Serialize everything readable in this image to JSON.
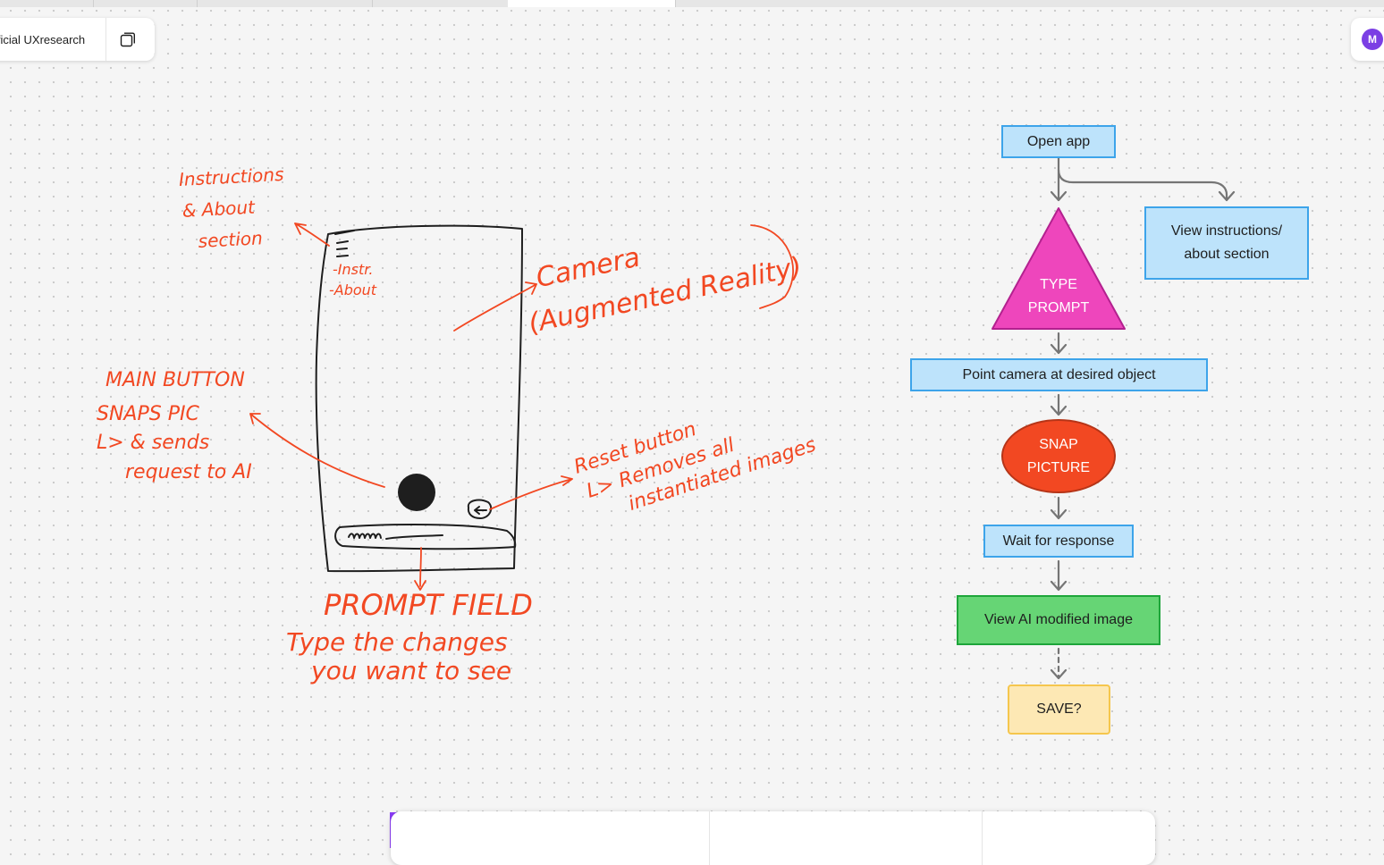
{
  "file": {
    "name": "ificial UXresearch"
  },
  "user": {
    "initial": "M"
  },
  "colors": {
    "annotation": "#f24822",
    "flow_blue": "#bde3fb",
    "flow_pink": "#ee46bc",
    "flow_red": "#f24822",
    "flow_green": "#66d575",
    "flow_yellow": "#fde8b4",
    "accent": "#7b3fe4"
  },
  "sketch_notes": {
    "instructions": [
      "Instructions",
      "& About",
      "section"
    ],
    "menu_items": [
      "-Instr.",
      "-About"
    ],
    "camera": [
      "Camera",
      "(Augmented Reality)"
    ],
    "main_button": [
      "MAIN BUTTON",
      "SNAPS PIC",
      "L> & sends",
      "request to AI"
    ],
    "reset_button": [
      "Reset button",
      "L> Removes all",
      "instantiated images"
    ],
    "prompt_field": [
      "PROMPT FIELD",
      "Type the changes",
      "you want to see"
    ]
  },
  "flow": {
    "open_app": "Open app",
    "view_instructions": [
      "View instructions/",
      "about section"
    ],
    "type_prompt": [
      "TYPE",
      "PROMPT"
    ],
    "point_camera": "Point camera at desired object",
    "snap_picture": [
      "SNAP",
      "PICTURE"
    ],
    "wait_response": "Wait for response",
    "view_ai_image": "View AI modified image",
    "save": "SAVE?"
  },
  "toolbar": {
    "tools": [
      "move-tool",
      "pencil-tool",
      "sticky-note-tool",
      "shape-tool",
      "text-tool",
      "section-tool",
      "table-tool",
      "stamp-tool",
      "widgets-tool",
      "stickers-tool",
      "more-tool"
    ]
  }
}
